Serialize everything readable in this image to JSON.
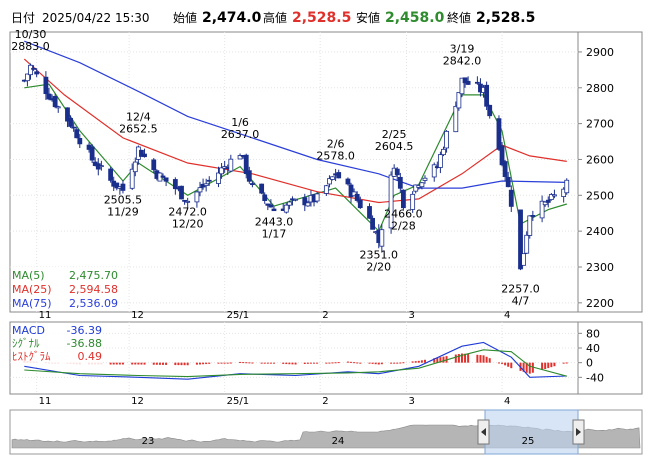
{
  "header": {
    "date_label": "日付",
    "datetime": "2025/04/22 15:30",
    "open_label": "始値",
    "open_value": "2,474.0",
    "high_label": "高値",
    "high_value": "2,528.5",
    "low_label": "安値",
    "low_value": "2,458.0",
    "close_label": "終値",
    "close_value": "2,528.5"
  },
  "colors": {
    "up_candle": "#ffffff",
    "down_candle": "#1a2e8c",
    "ma5": "#2e8b2e",
    "ma25": "#e0302b",
    "ma75": "#2b3fd9",
    "macd": "#1f3bd6",
    "signal": "#2e8b2e",
    "histogram": "#e0302b",
    "volume_area": "#9a9a9a"
  },
  "chart_data": [
    {
      "type": "line",
      "subtype": "candlestick",
      "ylim": [
        2180,
        2950
      ],
      "yticks": [
        2200,
        2300,
        2400,
        2500,
        2600,
        2700,
        2800,
        2900
      ],
      "xtick_labels": [
        "11",
        "12",
        "25/1",
        "2",
        "3",
        "4"
      ],
      "legend": [
        {
          "name": "MA(5)",
          "value": "2,475.70",
          "color": "#2e8b2e"
        },
        {
          "name": "MA(25)",
          "value": "2,594.58",
          "color": "#e0302b"
        },
        {
          "name": "MA(75)",
          "value": "2,536.09",
          "color": "#2b3fd9"
        }
      ],
      "legend_placement": "bottom-left",
      "annotations": [
        {
          "date": "10/30",
          "value": "2883.0",
          "kind": "high"
        },
        {
          "date": "11/29",
          "value": "2505.5",
          "kind": "low"
        },
        {
          "date": "12/4",
          "value": "2652.5",
          "kind": "high"
        },
        {
          "date": "12/20",
          "value": "2472.0",
          "kind": "low"
        },
        {
          "date": "1/6",
          "value": "2637.0",
          "kind": "high"
        },
        {
          "date": "1/17",
          "value": "2443.0",
          "kind": "low"
        },
        {
          "date": "2/6",
          "value": "2578.0",
          "kind": "high"
        },
        {
          "date": "2/20",
          "value": "2351.0",
          "kind": "low"
        },
        {
          "date": "2/25",
          "value": "2604.5",
          "kind": "high"
        },
        {
          "date": "2/28",
          "value": "2466.0",
          "kind": "low"
        },
        {
          "date": "3/19",
          "value": "2842.0",
          "kind": "high"
        },
        {
          "date": "4/7",
          "value": "2257.0",
          "kind": "low"
        }
      ],
      "close_path": [
        [
          "10/28",
          2820
        ],
        [
          "10/30",
          2860
        ],
        [
          "11/5",
          2780
        ],
        [
          "11/12",
          2700
        ],
        [
          "11/19",
          2600
        ],
        [
          "11/25",
          2540
        ],
        [
          "11/29",
          2515
        ],
        [
          "12/4",
          2630
        ],
        [
          "12/10",
          2560
        ],
        [
          "12/16",
          2520
        ],
        [
          "12/20",
          2485
        ],
        [
          "12/27",
          2540
        ],
        [
          "1/6",
          2620
        ],
        [
          "1/10",
          2520
        ],
        [
          "1/17",
          2460
        ],
        [
          "1/24",
          2480
        ],
        [
          "1/31",
          2490
        ],
        [
          "2/6",
          2560
        ],
        [
          "2/12",
          2500
        ],
        [
          "2/18",
          2420
        ],
        [
          "2/20",
          2370
        ],
        [
          "2/25",
          2590
        ],
        [
          "2/28",
          2480
        ],
        [
          "3/5",
          2540
        ],
        [
          "3/11",
          2580
        ],
        [
          "3/19",
          2820
        ],
        [
          "3/26",
          2790
        ],
        [
          "4/1",
          2600
        ],
        [
          "4/4",
          2480
        ],
        [
          "4/7",
          2290
        ],
        [
          "4/10",
          2450
        ],
        [
          "4/16",
          2480
        ],
        [
          "4/22",
          2528.5
        ]
      ],
      "series": [
        {
          "name": "MA(5)",
          "values": [
            [
              "10/28",
              2800
            ],
            [
              "11/5",
              2810
            ],
            [
              "11/15",
              2680
            ],
            [
              "11/29",
              2540
            ],
            [
              "12/4",
              2590
            ],
            [
              "12/20",
              2500
            ],
            [
              "1/6",
              2580
            ],
            [
              "1/17",
              2470
            ],
            [
              "2/6",
              2520
            ],
            [
              "2/20",
              2400
            ],
            [
              "2/25",
              2500
            ],
            [
              "3/5",
              2530
            ],
            [
              "3/19",
              2780
            ],
            [
              "3/26",
              2780
            ],
            [
              "4/1",
              2680
            ],
            [
              "4/7",
              2420
            ],
            [
              "4/16",
              2460
            ],
            [
              "4/22",
              2475.7
            ]
          ]
        },
        {
          "name": "MA(25)",
          "values": [
            [
              "10/28",
              2880
            ],
            [
              "11/10",
              2780
            ],
            [
              "11/29",
              2660
            ],
            [
              "12/20",
              2590
            ],
            [
              "1/10",
              2560
            ],
            [
              "1/31",
              2510
            ],
            [
              "2/20",
              2480
            ],
            [
              "3/5",
              2490
            ],
            [
              "3/19",
              2560
            ],
            [
              "4/1",
              2640
            ],
            [
              "4/10",
              2610
            ],
            [
              "4/22",
              2594.58
            ]
          ]
        },
        {
          "name": "MA(75)",
          "values": [
            [
              "10/28",
              2930
            ],
            [
              "11/15",
              2870
            ],
            [
              "12/4",
              2790
            ],
            [
              "12/20",
              2720
            ],
            [
              "1/10",
              2660
            ],
            [
              "1/31",
              2600
            ],
            [
              "2/20",
              2560
            ],
            [
              "3/5",
              2520
            ],
            [
              "3/19",
              2520
            ],
            [
              "4/1",
              2540
            ],
            [
              "4/22",
              2536.09
            ]
          ]
        }
      ]
    },
    {
      "type": "line",
      "subtype": "macd",
      "ylim": [
        -80,
        100
      ],
      "yticks": [
        80,
        40,
        0,
        -40
      ],
      "xtick_labels": [
        "11",
        "12",
        "25/1",
        "2",
        "3",
        "4"
      ],
      "legend": [
        {
          "name": "MACD",
          "value": "-36.39",
          "color": "#1f3bd6"
        },
        {
          "name": "ｼｸﾞﾅﾙ",
          "value": "-36.88",
          "color": "#2e8b2e"
        },
        {
          "name": "ﾋｽﾄｸﾞﾗﾑ",
          "value": "0.49",
          "color": "#e0302b"
        }
      ],
      "series": [
        {
          "name": "MACD",
          "values": [
            [
              "10/28",
              -10
            ],
            [
              "11/15",
              -35
            ],
            [
              "12/4",
              -40
            ],
            [
              "12/20",
              -45
            ],
            [
              "1/6",
              -30
            ],
            [
              "1/24",
              -35
            ],
            [
              "2/10",
              -25
            ],
            [
              "2/20",
              -30
            ],
            [
              "3/5",
              -10
            ],
            [
              "3/19",
              45
            ],
            [
              "3/26",
              55
            ],
            [
              "4/4",
              15
            ],
            [
              "4/10",
              -40
            ],
            [
              "4/22",
              -36.39
            ]
          ]
        },
        {
          "name": "ｼｸﾞﾅﾙ",
          "values": [
            [
              "10/28",
              -20
            ],
            [
              "11/15",
              -30
            ],
            [
              "12/4",
              -35
            ],
            [
              "12/20",
              -38
            ],
            [
              "1/6",
              -32
            ],
            [
              "1/24",
              -30
            ],
            [
              "2/10",
              -28
            ],
            [
              "2/20",
              -25
            ],
            [
              "3/5",
              -15
            ],
            [
              "3/19",
              20
            ],
            [
              "3/26",
              35
            ],
            [
              "4/4",
              30
            ],
            [
              "4/10",
              -10
            ],
            [
              "4/22",
              -36.88
            ]
          ]
        },
        {
          "name": "ﾋｽﾄｸﾞﾗﾑ",
          "values": [
            [
              "10/28",
              5
            ],
            [
              "11/15",
              -5
            ],
            [
              "12/4",
              -5
            ],
            [
              "12/20",
              -7
            ],
            [
              "1/6",
              2
            ],
            [
              "1/24",
              -5
            ],
            [
              "2/10",
              3
            ],
            [
              "2/20",
              -5
            ],
            [
              "3/5",
              5
            ],
            [
              "3/19",
              25
            ],
            [
              "3/26",
              20
            ],
            [
              "4/4",
              -15
            ],
            [
              "4/10",
              -30
            ],
            [
              "4/22",
              0.49
            ]
          ]
        }
      ]
    }
  ],
  "navigator": {
    "labels": [
      "23",
      "24",
      "25"
    ],
    "left_handle_icon": "chevron-left-icon",
    "right_handle_icon": "chevron-right-icon"
  }
}
